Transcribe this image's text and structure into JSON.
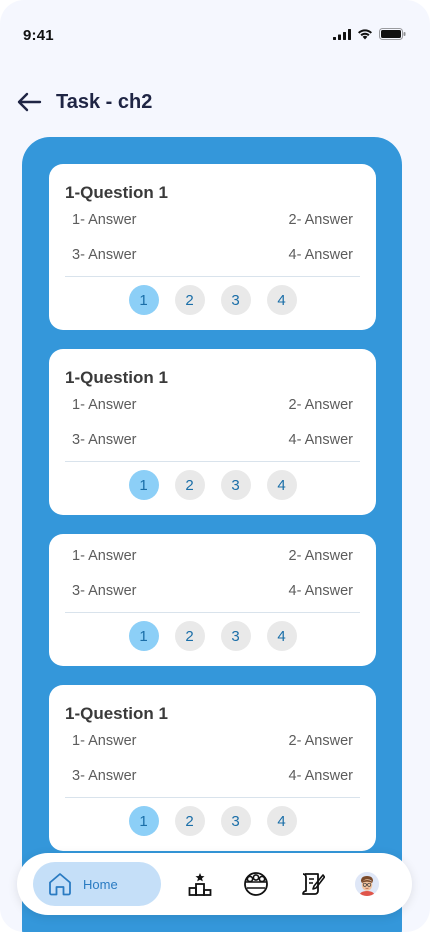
{
  "status": {
    "time": "9:41"
  },
  "header": {
    "title": "Task - ch2",
    "back_icon": "arrow-left-icon"
  },
  "colors": {
    "panel": "#3497da",
    "active_page": "#8ccff7",
    "nav_active": "#c5dff8"
  },
  "cards": [
    {
      "title": "1-Question 1",
      "answers": [
        "1- Answer",
        "2- Answer",
        "3- Answer",
        "4- Answer"
      ],
      "pages": [
        "1",
        "2",
        "3",
        "4"
      ],
      "active_page": "1"
    },
    {
      "title": "1-Question 1",
      "answers": [
        "1- Answer",
        "2- Answer",
        "3- Answer",
        "4- Answer"
      ],
      "pages": [
        "1",
        "2",
        "3",
        "4"
      ],
      "active_page": "1"
    },
    {
      "title": "",
      "answers": [
        "1- Answer",
        "2- Answer",
        "3- Answer",
        "4- Answer"
      ],
      "pages": [
        "1",
        "2",
        "3",
        "4"
      ],
      "active_page": "1"
    },
    {
      "title": "1-Question 1",
      "answers": [
        "1- Answer",
        "2- Answer",
        "3- Answer",
        "4- Answer"
      ],
      "pages": [
        "1",
        "2",
        "3",
        "4"
      ],
      "active_page": "1"
    }
  ],
  "nav": {
    "home_label": "Home",
    "icons": [
      "home-icon",
      "podium-icon",
      "community-icon",
      "scroll-quill-icon",
      "profile-avatar"
    ]
  }
}
